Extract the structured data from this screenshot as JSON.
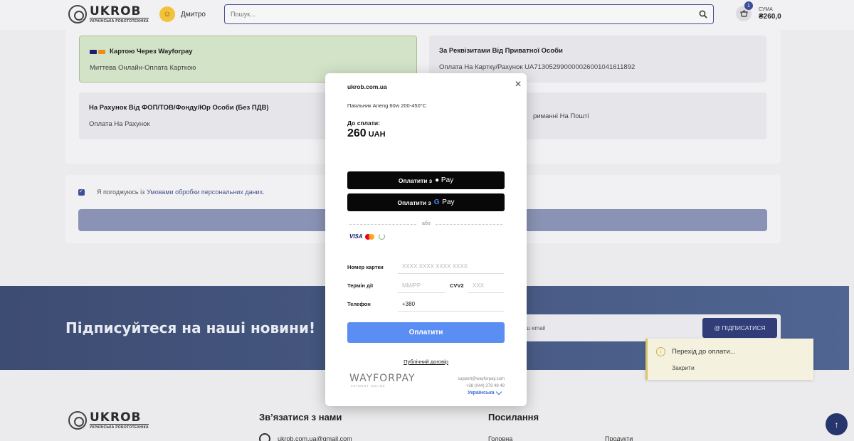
{
  "header": {
    "logo_word": "UKROB",
    "logo_sub": "УКРАЇНСЬКА РОБОТОТЕХНІКА",
    "user_name": "Дмитро",
    "search_placeholder": "Пошук...",
    "cart_count": "1",
    "sum_label": "СУМА",
    "sum_value": "₴260,0"
  },
  "payment_options": [
    {
      "title": "Картою Через Wayforpay",
      "desc": "Миттева Онлайн-Оплата Карткою",
      "selected": true
    },
    {
      "title": "За Реквізитами Від Приватної Особи",
      "desc": "Оплата На Картку/Рахунок UA713052990000026001041611892",
      "selected": false
    },
    {
      "title": "На Рахунок Від ФОП/ТОВ/Фонду/Юр Особи (Без ПДВ)",
      "desc": "Оплата На Рахунок",
      "selected": false
    },
    {
      "title": "",
      "desc": "риманні На Пошті",
      "selected": false
    }
  ],
  "agreement": {
    "prefix": "Я погоджуюсь із",
    "link": "Умовами обробки персональних даних",
    "suffix": "."
  },
  "newsletter": {
    "title": "Підписуйтеся на наші новини!",
    "placeholder": "аш email",
    "button": "@ ПІДПИСАТИСЯ"
  },
  "footer": {
    "contact_title": "Зв’язатися з нами",
    "links_title": "Посилання",
    "email": "ukrob.com.ua@gmail.com",
    "link_home": "Головна",
    "link_products": "Продукти"
  },
  "toast": {
    "message": "Перехід до оплати...",
    "close": "Закрити"
  },
  "modal": {
    "domain": "ukrob.com.ua",
    "product": "Паяльник Aneng 60w 200-450°C",
    "due_label": "До сплати:",
    "amount": "260",
    "currency": "UAH",
    "apple_prefix": "Оплатити з",
    "apple_brand": "Pay",
    "google_prefix": "Оплатити з",
    "google_brand": "Pay",
    "google_g": "G",
    "divider": "або",
    "visa": "VISA",
    "card_number_label": "Номер картки",
    "card_number_placeholder": "XXXX XXXX XXXX XXXX",
    "expiry_label": "Термін дії",
    "expiry_placeholder": "MM/PP",
    "cvv_label": "CVV2",
    "cvv_placeholder": "XXX",
    "phone_label": "Телефон",
    "phone_value": "+380",
    "pay_button": "Оплатити",
    "contract": "Публічний договір",
    "brand_logo": "WAYFORPAY",
    "brand_sub": "PAYMENT ONLINE",
    "support_email": "support@wayforpay.com",
    "support_phone": "+38 (044) 379 48 49",
    "language": "Українська"
  },
  "colors": {
    "accent": "#3c4e9a",
    "pay_blue": "#5b8ef2",
    "selected_option": "#d3e3c8"
  }
}
